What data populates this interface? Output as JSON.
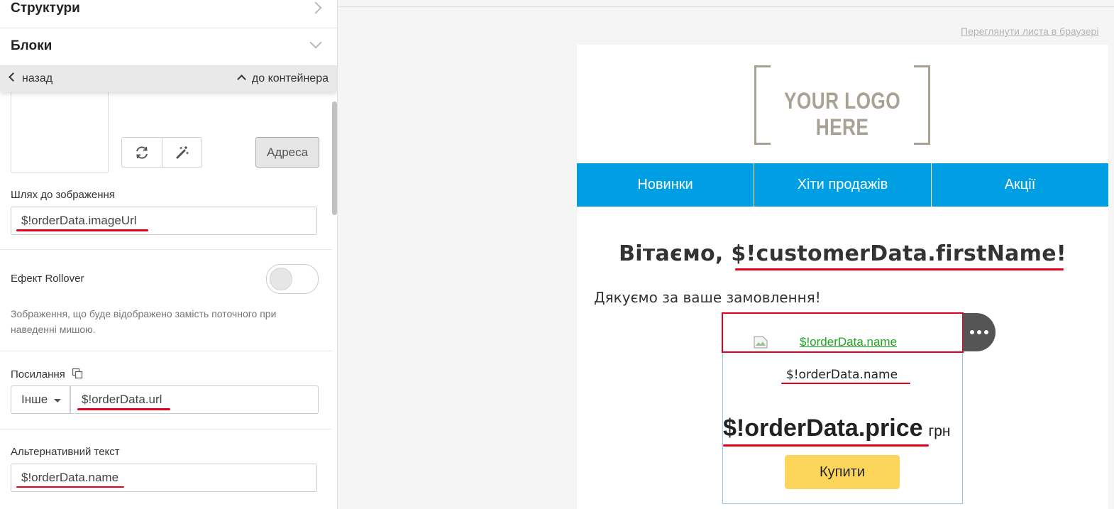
{
  "sidebar": {
    "sections": {
      "structures": "Структури",
      "blocks": "Блоки"
    },
    "nav": {
      "back": "назад",
      "to_container": "до контейнера"
    },
    "image": {
      "address_button": "Адреса",
      "path_label": "Шлях до зображення",
      "path_value": "$!orderData.imageUrl"
    },
    "rollover": {
      "label": "Ефект Rollover",
      "enabled": false,
      "hint": "Зображення, що буде відображено замість поточного при наведенні мишою."
    },
    "link": {
      "label": "Посилання",
      "type": "Інше",
      "url": "$!orderData.url"
    },
    "alt": {
      "label": "Альтернативний текст",
      "value": "$!orderData.name"
    }
  },
  "preview": {
    "view_in_browser": "Переглянути листа в браузері",
    "logo_text": "YOUR LOGO HERE",
    "menu": [
      "Новинки",
      "Хіти продажів",
      "Акції"
    ],
    "greeting": "Вітаємо, $!customerData.firstName!",
    "thanks": "Дякуємо за ваше замовлення!",
    "product": {
      "image_alt_link": "$!orderData.name",
      "name": "$!orderData.name",
      "price": "$!orderData.price",
      "currency": "грн",
      "buy_label": "Купити"
    }
  },
  "colors": {
    "menu_bg": "#009fe3",
    "buy_button": "#fdd55b",
    "highlight_red": "#e3001b",
    "link_green": "#1fa81f"
  }
}
